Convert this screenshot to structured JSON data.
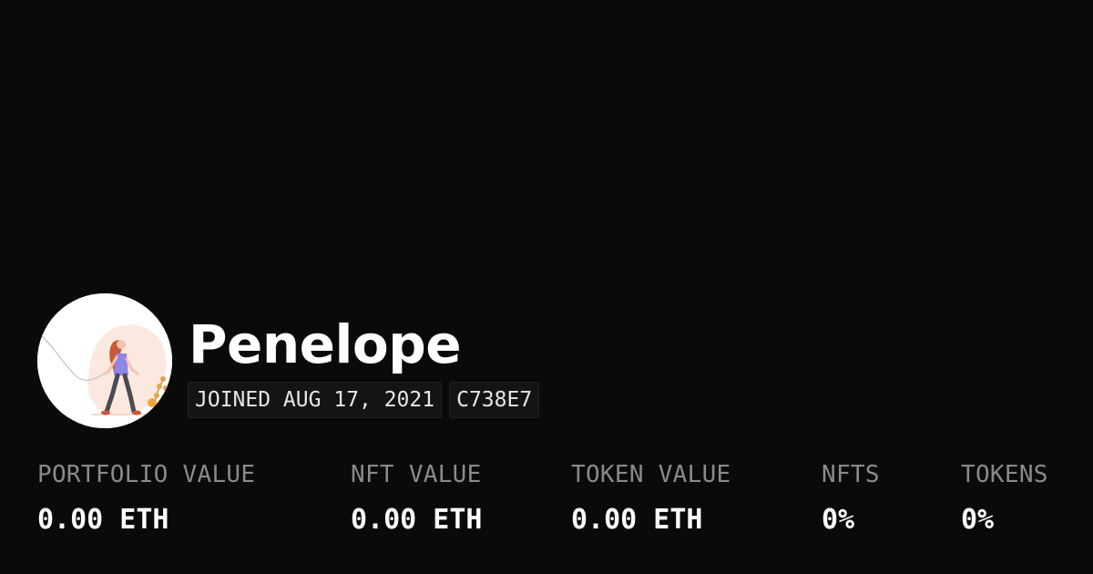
{
  "profile": {
    "name": "Penelope",
    "avatar_icon": "woman-walking-illustration-icon",
    "joined": "JOINED AUG 17, 2021",
    "id_tag": "C738E7"
  },
  "stats": [
    {
      "label": "PORTFOLIO VALUE",
      "value": "0.00 ETH"
    },
    {
      "label": "NFT VALUE",
      "value": "0.00 ETH"
    },
    {
      "label": "TOKEN VALUE",
      "value": "0.00 ETH"
    },
    {
      "label": "NFTS",
      "value": "0%"
    },
    {
      "label": "TOKENS",
      "value": "0%"
    }
  ],
  "colors": {
    "background": "#0a0a0a",
    "label": "#8a8a8a",
    "value": "#ffffff"
  }
}
